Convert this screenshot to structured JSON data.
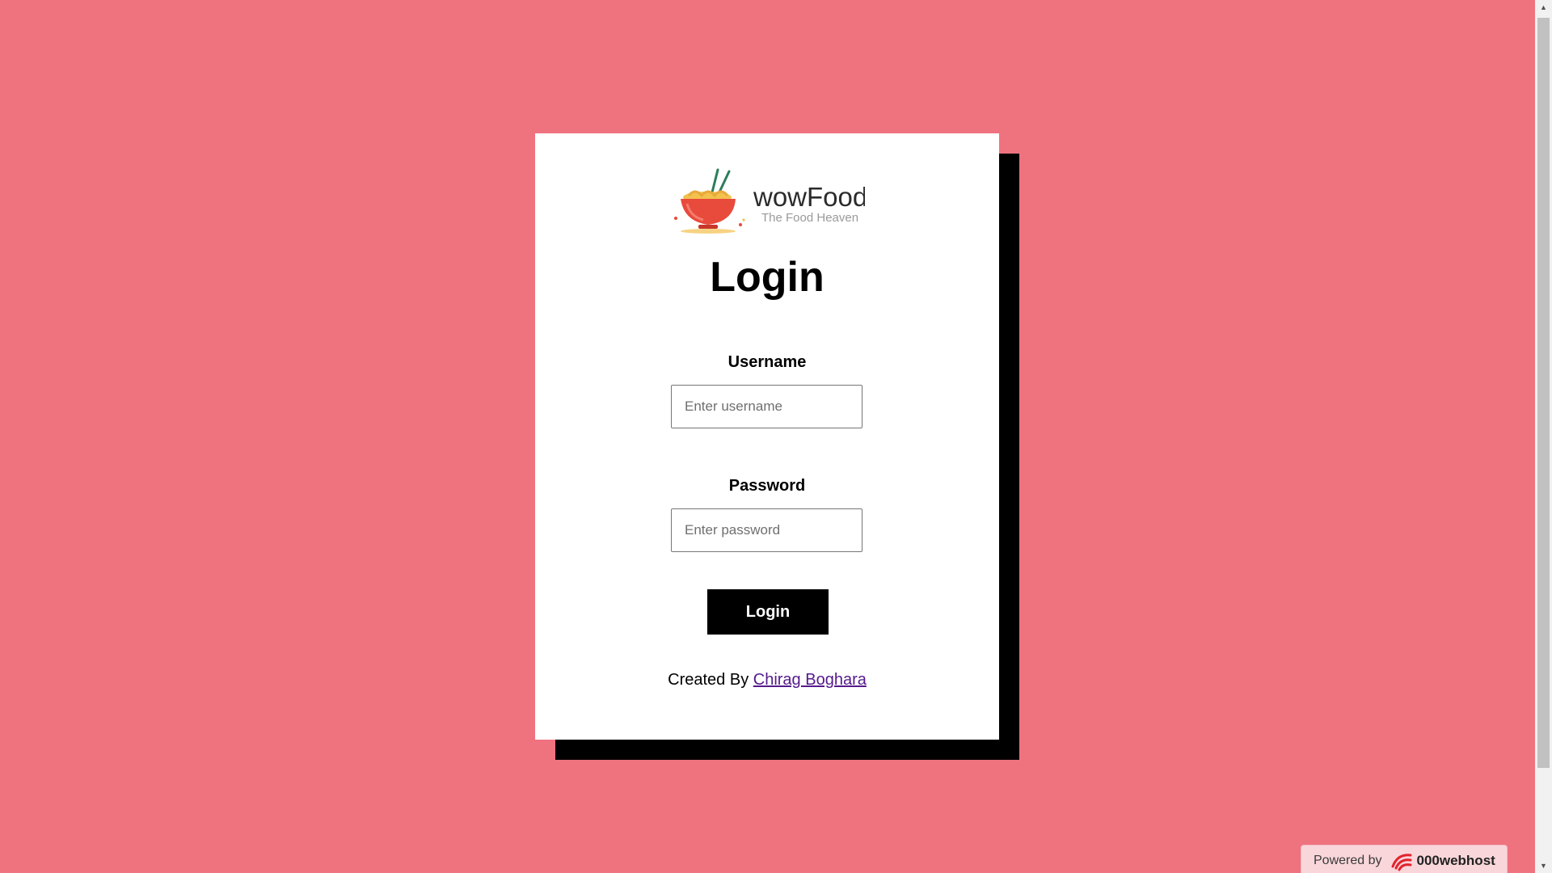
{
  "brand": {
    "name": "wowFood",
    "tagline": "The Food Heaven",
    "logo_icon": "food-bowl-chopsticks-icon"
  },
  "page": {
    "title": "Login"
  },
  "form": {
    "username_label": "Username",
    "username_placeholder": "Enter username",
    "username_value": "",
    "password_label": "Password",
    "password_placeholder": "Enter password",
    "password_value": "",
    "submit_label": "Login"
  },
  "footer": {
    "created_by": "Created By",
    "author": "Chirag Boghara"
  },
  "badge": {
    "powered_by": "Powered by",
    "host_name": "000webhost",
    "host_icon": "000webhost-logo-icon"
  },
  "colors": {
    "background": "#ee737f",
    "card": "#ffffff",
    "shadow": "#000000",
    "button": "#000000",
    "link": "#551a8b"
  }
}
